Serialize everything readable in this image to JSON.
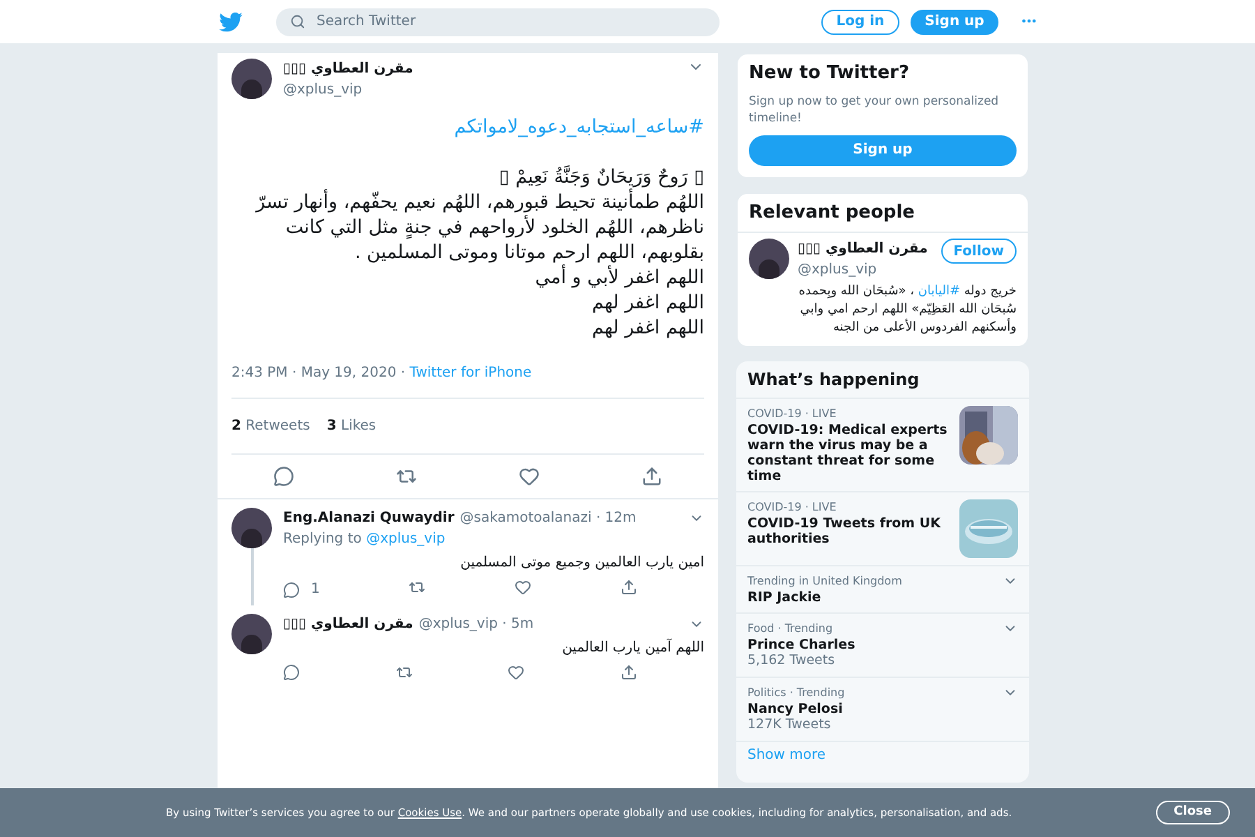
{
  "header": {
    "search": {
      "placeholder": "Search Twitter"
    },
    "login": "Log in",
    "signup": "Sign up",
    "more": "•••"
  },
  "tweet": {
    "name": "مقرن العطاوي ▯▯▯",
    "handle": "@xplus_vip",
    "hashtag": "#ساعه_استجابه_دعوه_لامواتكم",
    "lines": [
      "▯ رَوحٌ وَرَيحَانٌ وَجَنَّةُ نَعِيمْ ▯",
      "اللهُم طمأنينة تحيط قبورهم، اللهُم نعيم يحفّهم، وأنهار تسرّ",
      "ناظرهم، اللهُم الخلود لأرواحهم في جنةٍ مثل التي كانت",
      "بقلوبهم، اللهم ارحم موتانا وموتى المسلمين .",
      "اللهم اغفر لأبي و أمي",
      "اللهم اغفر لهم",
      "اللهم اغفر لهم"
    ],
    "time": "2:43 PM · May 19, 2020 ·",
    "source": "Twitter for iPhone",
    "retweets": "2",
    "retweets_label": "Retweets",
    "likes": "3",
    "likes_label": "Likes"
  },
  "replies": [
    {
      "name": "Eng.Alanazi Quwaydir",
      "handle": "@sakamotoalanazi · 12m",
      "replying_label": "Replying to",
      "replying_to": "@xplus_vip",
      "text": "امين يارب العالمين وجميع موتى المسلمين",
      "reply_count": "1",
      "thread": true
    },
    {
      "name": "مقرن العطاوي ▯▯▯",
      "handle": "@xplus_vip · 5m",
      "text": "اللهم آمين يارب العالمين",
      "thread": false
    }
  ],
  "new_to_twitter": {
    "title": "New to Twitter?",
    "text": "Sign up now to get your own personalized timeline!",
    "button": "Sign up"
  },
  "relevant_people": {
    "title": "Relevant people",
    "name": "مقرن العطاوي ▯▯▯",
    "handle": "@xplus_vip",
    "follow": "Follow",
    "bio": [
      {
        "kind": "text",
        "text": "خريج دوله "
      },
      {
        "kind": "link",
        "text": "#اليابان"
      },
      {
        "kind": "text",
        "text": " ، «سُبحَان الله وبِحمده سُبحَان الله العَظِيّم» اللهم ارحم امي وابي وأسكنهم الفردوس الأعلى من الجنه"
      }
    ]
  },
  "whats_happening": {
    "title": "What’s happening",
    "items": [
      {
        "kind": "news",
        "meta": "COVID-19 · LIVE",
        "title": "COVID-19: Medical experts warn the virus may be a constant threat for some time"
      },
      {
        "kind": "news",
        "meta": "COVID-19 · LIVE",
        "title": "COVID-19 Tweets from UK authorities"
      },
      {
        "kind": "trend",
        "meta": "Trending in United Kingdom",
        "title": "RIP Jackie"
      },
      {
        "kind": "trend",
        "meta": "Food · Trending",
        "title": "Prince Charles",
        "count": "5,162 Tweets"
      },
      {
        "kind": "trend",
        "meta": "Politics · Trending",
        "title": "Nancy Pelosi",
        "count": "127K Tweets"
      }
    ],
    "show_more": "Show more"
  },
  "cookie_banner": {
    "text_before": "By using Twitter’s services you agree to our ",
    "link": "Cookies Use",
    "text_after": ". We and our partners operate globally and use cookies, including for analytics, personalisation, and ads.",
    "close": "Close"
  }
}
